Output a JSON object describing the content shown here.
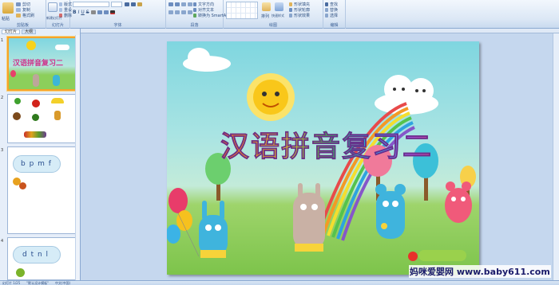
{
  "ribbon": {
    "groups": [
      {
        "label": "剪贴板"
      },
      {
        "label": "幻灯片"
      },
      {
        "label": "字体"
      },
      {
        "label": "段落"
      },
      {
        "label": "绘图"
      },
      {
        "label": "编辑"
      }
    ],
    "items": {
      "cut": "剪切",
      "copy": "复制",
      "format_painter": "格式刷",
      "paste": "粘贴",
      "new_slide": "新建幻灯片",
      "layout": "版式",
      "reset": "重设",
      "delete": "删除",
      "text_direction": "文字方向",
      "align_text": "对齐文本",
      "convert_smartart": "转换为 SmartArt",
      "arrange": "排列",
      "quick_styles": "快速样式",
      "shape_fill": "形状填充",
      "shape_outline": "形状轮廓",
      "shape_effects": "形状效果",
      "find": "查找",
      "replace": "替换",
      "select": "选择"
    }
  },
  "pane": {
    "tabs": [
      "幻灯片",
      "大纲"
    ]
  },
  "thumbnails": [
    {
      "num": "1",
      "title": "汉语拼音复习二"
    },
    {
      "num": "2",
      "text": ""
    },
    {
      "num": "3",
      "text": "b p m f"
    },
    {
      "num": "4",
      "text": "d t n l"
    }
  ],
  "slide": {
    "title": "汉语拼音复习二",
    "watermark": "妈咪爱婴网 www.baby611.com"
  },
  "status": {
    "slide": "幻灯片 1/25",
    "theme": "\"默认设计模板\"",
    "lang": "中文(中国)"
  }
}
